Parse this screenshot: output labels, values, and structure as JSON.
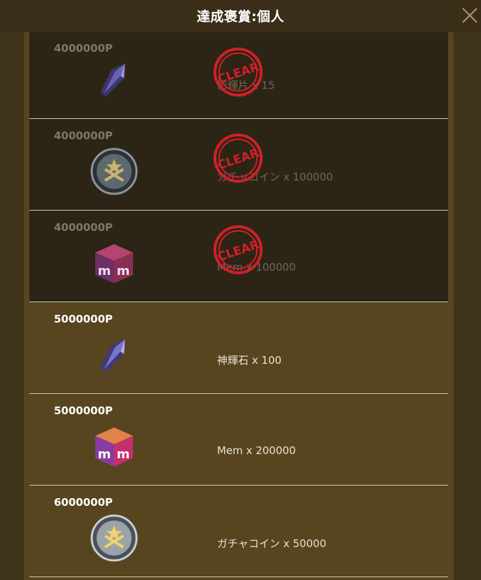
{
  "header": {
    "title": "達成褒賞:個人"
  },
  "stamp_text": "CLEAR",
  "colors": {
    "accent_stamp": "#d0202a",
    "panel": "#56451f",
    "cleared_row": "#2c2515"
  },
  "rewards": [
    {
      "points": "4000000P",
      "item": "影輝片 x 15",
      "icon": "crystal-shard-icon",
      "cleared": true
    },
    {
      "points": "4000000P",
      "item": "ガチャコイン x 100000",
      "icon": "gacha-coin-icon",
      "cleared": true
    },
    {
      "points": "4000000P",
      "item": "Mem x 100000",
      "icon": "mem-cube-icon",
      "cleared": true
    },
    {
      "points": "5000000P",
      "item": "神輝石 x 100",
      "icon": "crystal-shard-icon",
      "cleared": false
    },
    {
      "points": "5000000P",
      "item": "Mem x 200000",
      "icon": "mem-cube-icon",
      "cleared": false
    },
    {
      "points": "6000000P",
      "item": "ガチャコイン x 50000",
      "icon": "gacha-coin-icon",
      "cleared": false
    }
  ]
}
